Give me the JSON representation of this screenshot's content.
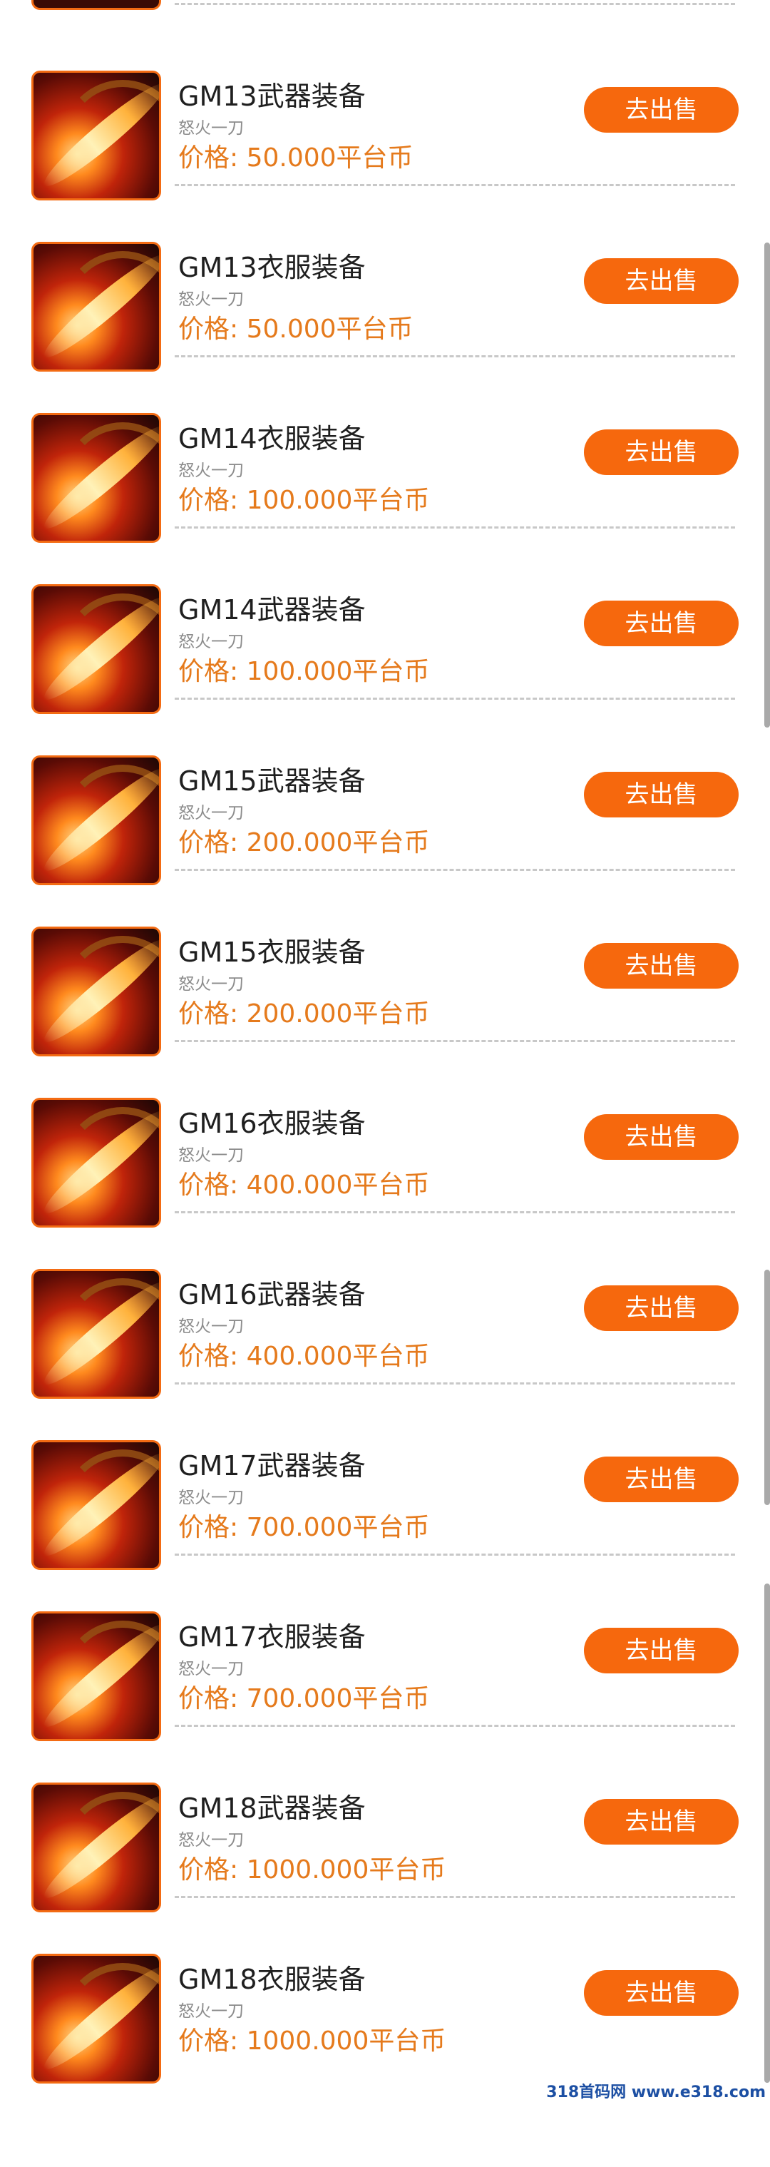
{
  "items": [
    {
      "title": "GM13武器装备",
      "sub": "怒火一刀",
      "price": "价格: 50.000平台币",
      "btn": "去出售"
    },
    {
      "title": "GM13衣服装备",
      "sub": "怒火一刀",
      "price": "价格: 50.000平台币",
      "btn": "去出售"
    },
    {
      "title": "GM14衣服装备",
      "sub": "怒火一刀",
      "price": "价格: 100.000平台币",
      "btn": "去出售"
    },
    {
      "title": "GM14武器装备",
      "sub": "怒火一刀",
      "price": "价格: 100.000平台币",
      "btn": "去出售"
    },
    {
      "title": "GM15武器装备",
      "sub": "怒火一刀",
      "price": "价格: 200.000平台币",
      "btn": "去出售"
    },
    {
      "title": "GM15衣服装备",
      "sub": "怒火一刀",
      "price": "价格: 200.000平台币",
      "btn": "去出售"
    },
    {
      "title": "GM16衣服装备",
      "sub": "怒火一刀",
      "price": "价格: 400.000平台币",
      "btn": "去出售"
    },
    {
      "title": "GM16武器装备",
      "sub": "怒火一刀",
      "price": "价格: 400.000平台币",
      "btn": "去出售"
    },
    {
      "title": "GM17武器装备",
      "sub": "怒火一刀",
      "price": "价格: 700.000平台币",
      "btn": "去出售"
    },
    {
      "title": "GM17衣服装备",
      "sub": "怒火一刀",
      "price": "价格: 700.000平台币",
      "btn": "去出售"
    },
    {
      "title": "GM18武器装备",
      "sub": "怒火一刀",
      "price": "价格: 1000.000平台币",
      "btn": "去出售"
    },
    {
      "title": "GM18衣服装备",
      "sub": "怒火一刀",
      "price": "价格: 1000.000平台币",
      "btn": "去出售"
    }
  ],
  "footer": "318首码网 www.e318.com",
  "colors": {
    "accent": "#f6680d",
    "price": "#e57a1c"
  }
}
